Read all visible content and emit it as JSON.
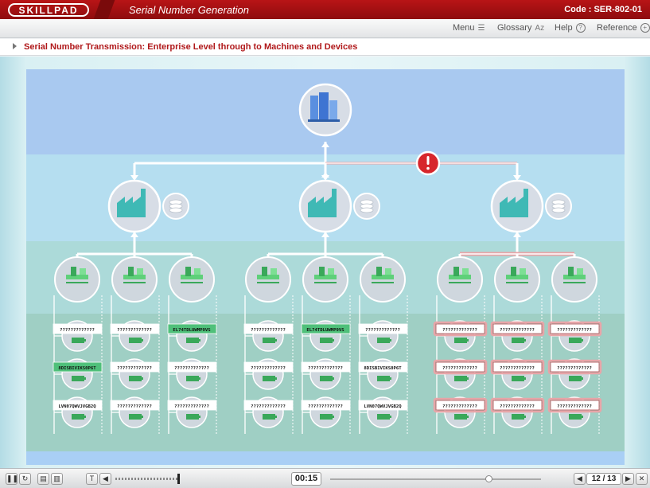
{
  "header": {
    "logo": "SKILLPAD",
    "course_title": "Serial Number Generation",
    "code": "Code :  SER-802-01"
  },
  "menubar": {
    "menu": "Menu",
    "glossary": "Glossary",
    "glossary_icon": "Az",
    "help": "Help",
    "reference": "Reference"
  },
  "section": {
    "title": "Serial Number Transmission: Enterprise Level through to Machines and Devices"
  },
  "diagram": {
    "colors": {
      "enterprise_band": "#a9c9f0",
      "site_band": "#b5def0",
      "line_band": "#acdad9",
      "device_band": "#9fcfc4",
      "alert": "#d7262c",
      "error_line": "#e8a5a8"
    },
    "groups": [
      {
        "status": "ok",
        "lines": [
          {
            "serials": [
              "?????????????",
              "8DISBIVIKS0P6T",
              "LVN07QWVJVGB2Q"
            ],
            "highlight": [
              false,
              true,
              false
            ]
          },
          {
            "serials": [
              "?????????????",
              "?????????????",
              "?????????????"
            ],
            "highlight": [
              false,
              false,
              false
            ]
          },
          {
            "serials": [
              "EL74TDLUWMP9VS",
              "?????????????",
              "?????????????"
            ],
            "highlight": [
              true,
              false,
              false
            ]
          }
        ]
      },
      {
        "status": "ok",
        "lines": [
          {
            "serials": [
              "?????????????",
              "?????????????",
              "?????????????"
            ],
            "highlight": [
              false,
              false,
              false
            ]
          },
          {
            "serials": [
              "EL74TDLUWMP9VS",
              "?????????????",
              "?????????????"
            ],
            "highlight": [
              true,
              false,
              false
            ]
          },
          {
            "serials": [
              "?????????????",
              "8DISBIVIKS0P6T",
              "LVN07QWVJVGB2Q"
            ],
            "highlight": [
              false,
              false,
              false
            ]
          }
        ]
      },
      {
        "status": "error",
        "lines": [
          {
            "serials": [
              "?????????????",
              "?????????????",
              "?????????????"
            ],
            "highlight": [
              false,
              false,
              false
            ]
          },
          {
            "serials": [
              "?????????????",
              "?????????????",
              "?????????????"
            ],
            "highlight": [
              false,
              false,
              false
            ]
          },
          {
            "serials": [
              "?????????????",
              "?????????????",
              "?????????????"
            ],
            "highlight": [
              false,
              false,
              false
            ]
          }
        ]
      }
    ]
  },
  "player": {
    "timer": "00:15",
    "page": "12 / 13",
    "volume_level": 1.0,
    "progress": 0.75
  }
}
